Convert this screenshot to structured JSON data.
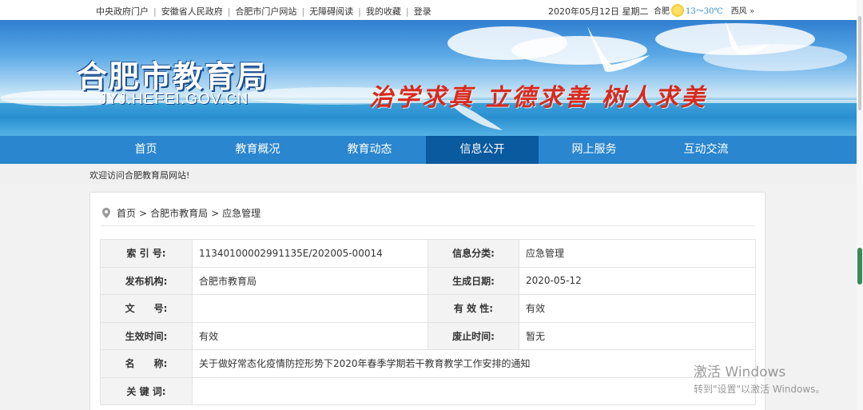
{
  "topbar": {
    "links": [
      "中央政府门户",
      "安徽省人民政府",
      "合肥市门户网站",
      "无障碍阅读",
      "我的收藏",
      "登录"
    ],
    "date": "2020年05月12日 星期二",
    "weather": {
      "city": "合肥",
      "temp": "13～30℃",
      "wind": "西风",
      "wind_icon": "»"
    }
  },
  "banner": {
    "logo": "合肥市教育局",
    "domain": "JYJ.HEFEI.GOV.CN",
    "motto": "治学求真  立德求善  树人求美"
  },
  "nav": {
    "items": [
      "首页",
      "教育概况",
      "教育动态",
      "信息公开",
      "网上服务",
      "互动交流"
    ],
    "active": "信息公开"
  },
  "welcome": "欢迎访问合肥教育局网站!",
  "breadcrumb": [
    "首页",
    "合肥市教育局",
    "应急管理"
  ],
  "info": {
    "index_label": "索 引 号:",
    "index_value": "11340100002991135E/202005-00014",
    "category_label": "信息分类:",
    "category_value": "应急管理",
    "publisher_label": "发布机构:",
    "publisher_value": "合肥市教育局",
    "created_label": "生成日期:",
    "created_value": "2020-05-12",
    "docno_label": "文　　号:",
    "docno_value": "",
    "validity_label": "有 效 性:",
    "validity_value": "有效",
    "effective_label": "生效时间:",
    "effective_value": "有效",
    "expire_label": "废止时间:",
    "expire_value": "暂无",
    "name_label": "名　　称:",
    "name_value": "关于做好常态化疫情防控形势下2020年春季学期若干教育教学工作安排的通知",
    "keywords_label": "关 键 词:",
    "keywords_value": ""
  },
  "watermark": {
    "line1": "激活 Windows",
    "line2": "转到\"设置\"以激活 Windows。"
  },
  "colors": {
    "nav": "#2a86cf",
    "nav_active": "#0a5aa0",
    "motto": "#d62b1f"
  }
}
